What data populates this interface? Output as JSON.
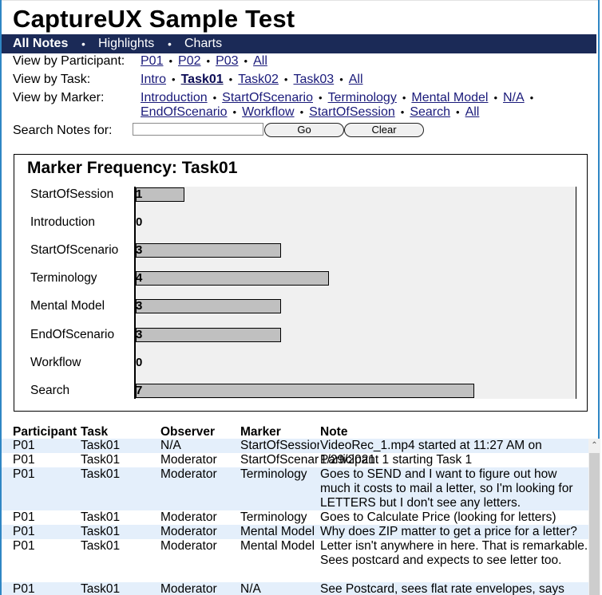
{
  "page": {
    "title": "CaptureUX Sample Test"
  },
  "nav": {
    "items": [
      {
        "label": "All Notes",
        "active": true
      },
      {
        "label": "Highlights",
        "active": false
      },
      {
        "label": "Charts",
        "active": false
      }
    ],
    "separator": "•"
  },
  "filters": {
    "participant": {
      "label": "View by Participant:",
      "links": [
        "P01",
        "P02",
        "P03",
        "All"
      ]
    },
    "task": {
      "label": "View by Task:",
      "links": [
        "Intro",
        "Task01",
        "Task02",
        "Task03",
        "All"
      ],
      "current": "Task01"
    },
    "marker": {
      "label": "View by Marker:",
      "links": [
        "Introduction",
        "StartOfScenario",
        "Terminology",
        "Mental Model",
        "N/A",
        "EndOfScenario",
        "Workflow",
        "StartOfSession",
        "Search",
        "All"
      ]
    },
    "separator": "•"
  },
  "search": {
    "label": "Search Notes for:",
    "value": "",
    "placeholder": "",
    "go_label": "Go",
    "clear_label": "Clear"
  },
  "chart_data": {
    "type": "bar",
    "orientation": "horizontal",
    "title": "Marker Frequency: Task01",
    "categories": [
      "StartOfSession",
      "Introduction",
      "StartOfScenario",
      "Terminology",
      "Mental Model",
      "EndOfScenario",
      "Workflow",
      "Search"
    ],
    "values": [
      1,
      0,
      3,
      4,
      3,
      3,
      0,
      7
    ],
    "xlim": [
      0,
      9.1
    ],
    "xlabel": "",
    "ylabel": "",
    "grid": false,
    "data_labels": true,
    "colors": {
      "bar": "#c0c0c0",
      "plot_bg": "#f0f0f0"
    }
  },
  "table": {
    "headers": [
      "Participant",
      "Task",
      "Observer",
      "Marker",
      "Note"
    ],
    "rows": [
      {
        "participant": "P01",
        "task": "Task01",
        "observer": "N/A",
        "marker": "StartOfSession",
        "note": "VideoRec_1.mp4 started at 11:27 AM on 1/29/2021"
      },
      {
        "participant": "P01",
        "task": "Task01",
        "observer": "Moderator",
        "marker": "StartOfScenario",
        "note": "Participant 1 starting Task 1"
      },
      {
        "participant": "P01",
        "task": "Task01",
        "observer": "Moderator",
        "marker": "Terminology",
        "note": "Goes to SEND and I want to figure out how much it costs to mail a letter, so I'm looking for LETTERS but I don't see any letters."
      },
      {
        "participant": "P01",
        "task": "Task01",
        "observer": "Moderator",
        "marker": "Terminology",
        "note": "Goes to Calculate Price (looking for letters)"
      },
      {
        "participant": "P01",
        "task": "Task01",
        "observer": "Moderator",
        "marker": "Mental Model",
        "note": "Why does ZIP matter to get a price for a letter?"
      },
      {
        "participant": "P01",
        "task": "Task01",
        "observer": "Moderator",
        "marker": "Mental Model",
        "note": "Letter isn't anywhere in here. That is remarkable. Sees postcard and expects to see letter too."
      },
      {
        "participant": "P01",
        "task": "Task01",
        "observer": "Moderator",
        "marker": "N/A",
        "note": "See Postcard, sees flat rate envelopes, says"
      }
    ]
  },
  "colors": {
    "nav_bg": "#1b2a57",
    "link": "#1a1a7a",
    "row_alt": "#e4effb",
    "frame_border": "#2f86c4"
  }
}
